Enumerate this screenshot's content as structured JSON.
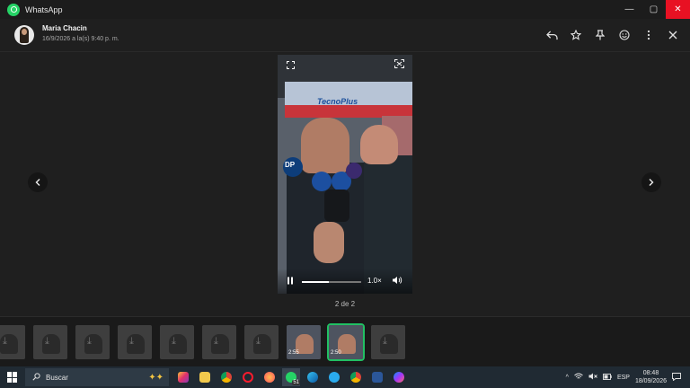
{
  "titlebar": {
    "app_title": "WhatsApp",
    "minimize": "—",
    "maximize": "▢",
    "close": "✕"
  },
  "header": {
    "contact_name": "Maria Chacin",
    "timestamp": "16/9/2026 a la(s) 9:40 p. m.",
    "icons": [
      "reply-icon",
      "star-icon",
      "pin-icon",
      "emoji-icon",
      "more-icon",
      "close-icon"
    ]
  },
  "viewer": {
    "counter": "2 de 2",
    "video": {
      "store_text": "TecnoPlus",
      "mic_label": "DP",
      "speed": "1.0×",
      "progress_fraction": 0.45
    }
  },
  "thumbnails": [
    {
      "duration": ""
    },
    {
      "duration": ""
    },
    {
      "duration": ""
    },
    {
      "duration": ""
    },
    {
      "duration": ""
    },
    {
      "duration": ""
    },
    {
      "duration": ""
    },
    {
      "duration": "2:55"
    },
    {
      "duration": "2:50",
      "selected": true
    },
    {
      "duration": ""
    }
  ],
  "taskbar": {
    "search_placeholder": "Buscar",
    "apps": [
      "instagram",
      "file-explorer",
      "chrome",
      "opera",
      "firefox",
      "whatsapp",
      "edge",
      "telegram",
      "chrome-profile",
      "word",
      "messenger"
    ],
    "whatsapp_badge": "51",
    "language": "ESP",
    "time": "08:48",
    "date": "18/09/2026"
  },
  "colors": {
    "accent": "#21c063",
    "close_red": "#e81123"
  }
}
